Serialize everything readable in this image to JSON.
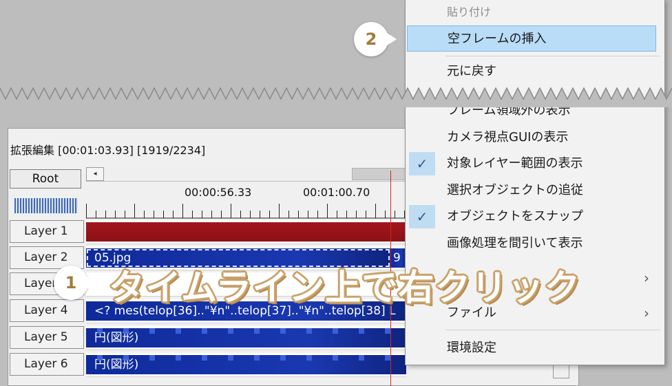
{
  "timeline": {
    "title": "拡張編集 [00:01:03.93] [1919/2234]",
    "root_label": "Root",
    "scroll_left_symbol": "◂",
    "ruler_labels": [
      "00:00:56.33",
      "00:01:00.70"
    ],
    "layers": [
      {
        "label": "Layer 1",
        "clip_text": "",
        "clip_color": "red"
      },
      {
        "label": "Layer 2",
        "clip_text": "05.jpg",
        "clip_color": "blue",
        "tail_text": "9"
      },
      {
        "label": "Layer 3",
        "clip_text": "",
        "clip_color": "none"
      },
      {
        "label": "Layer 4",
        "clip_text": "<? mes(telop[36]..\"¥n\"..telop[37]..\"¥n\"..telop[38] L",
        "clip_color": "blue"
      },
      {
        "label": "Layer 5",
        "clip_text": "円(図形)",
        "clip_color": "blue"
      },
      {
        "label": "Layer 6",
        "clip_text": "円(図形)",
        "clip_color": "blue"
      }
    ]
  },
  "context_menu": {
    "items": [
      {
        "label": "貼り付け",
        "state": "disabled"
      },
      {
        "label": "空フレームの挿入",
        "state": "highlighted"
      },
      {
        "label": "元に戻す",
        "state": "normal"
      },
      {
        "label": "フレーム領域外の表示",
        "state": "normal"
      },
      {
        "label": "カメラ視点GUIの表示",
        "state": "normal"
      },
      {
        "label": "対象レイヤー範囲の表示",
        "state": "checked"
      },
      {
        "label": "選択オブジェクトの追従",
        "state": "normal"
      },
      {
        "label": "オブジェクトをスナップ",
        "state": "checked"
      },
      {
        "label": "画像処理を間引いて表示",
        "state": "normal"
      },
      {
        "label": "",
        "state": "submenu"
      },
      {
        "label": "ファイル",
        "state": "submenu"
      },
      {
        "label": "環境設定",
        "state": "normal"
      }
    ],
    "check_symbol": "✓",
    "submenu_arrow": "›"
  },
  "callouts": {
    "step1": "1",
    "step2": "2",
    "annotation_text": "タイムライン上で右クリック"
  },
  "colors": {
    "highlight": "#b9dcf7",
    "layer_red": "#8c1016",
    "layer_blue": "#1a38b0",
    "annotation_outline": "#c9a26a",
    "badge_text": "#a07d3a"
  }
}
